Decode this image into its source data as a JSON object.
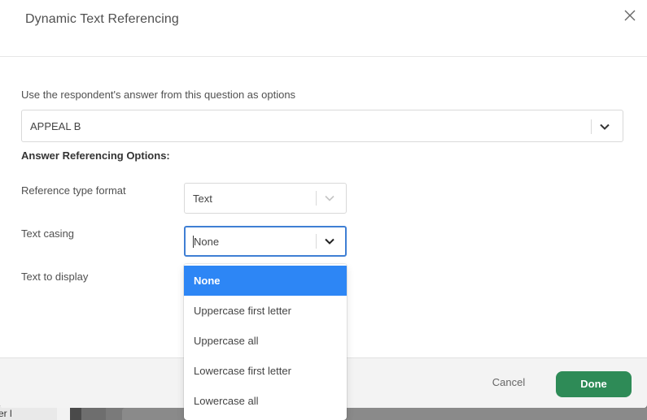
{
  "modal": {
    "title": "Dynamic Text Referencing"
  },
  "source_question": {
    "label": "Use the respondent's answer from this question as options",
    "selected": "APPEAL B"
  },
  "options_section": {
    "heading": "Answer Referencing Options:",
    "reference_type": {
      "label": "Reference type format",
      "selected": "Text"
    },
    "text_casing": {
      "label": "Text casing",
      "selected": "None",
      "options": [
        "None",
        "Uppercase first letter",
        "Uppercase all",
        "Lowercase first letter",
        "Lowercase all"
      ],
      "highlighted_index": 0
    },
    "text_to_display": {
      "label": "Text to display"
    }
  },
  "footer": {
    "cancel_label": "Cancel",
    "done_label": "Done"
  },
  "background": {
    "fragment_text": "er l"
  },
  "colors": {
    "accent_blue": "#2d86f5",
    "focus_border": "#3f7fd4",
    "done_green": "#2e8b57"
  },
  "icons": {
    "close": "close-icon",
    "dropdown": "chevron-down-icon"
  }
}
